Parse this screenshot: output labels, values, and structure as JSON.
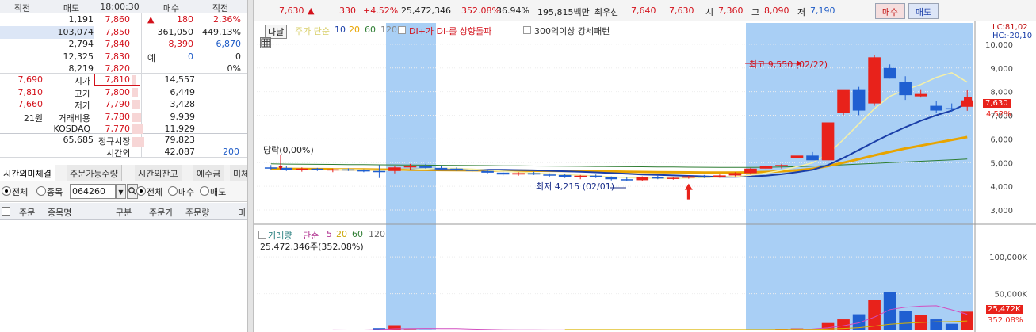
{
  "orderbook": {
    "headers": [
      "직전",
      "매도",
      "18:00:30",
      "매수",
      "직전"
    ],
    "ask_rows": [
      {
        "qty": "1,191",
        "price": "7,860",
        "bid": "180",
        "bidmark": "▲",
        "prev": "2.36%"
      },
      {
        "qty": "103,074",
        "price": "7,850",
        "bid": "361,050",
        "prev": "449.13%"
      },
      {
        "qty": "2,794",
        "price": "7,840",
        "bid": "8,390",
        "prev": "6,870"
      },
      {
        "qty": "12,325",
        "price": "7,830",
        "bidlabel": "예",
        "bid": "0",
        "prev": "0"
      },
      {
        "qty": "8,219",
        "price": "7,820",
        "prev": "0%"
      }
    ],
    "bid_rows": [
      {
        "left": "7,690",
        "label": "시가",
        "price": "7,810",
        "qty": "14,557"
      },
      {
        "left": "7,810",
        "label": "고가",
        "price": "7,800",
        "qty": "6,449"
      },
      {
        "left": "7,660",
        "label": "저가",
        "price": "7,790",
        "qty": "3,428"
      },
      {
        "left": "21원",
        "label": "거래비용",
        "price": "7,780",
        "qty": "9,939"
      },
      {
        "left": "",
        "label": "KOSDAQ",
        "price": "7,770",
        "qty": "11,929"
      }
    ],
    "summary": {
      "ask_total": "65,685",
      "session_label": "정규시장",
      "bid_total": "79,823",
      "after_label": "시간외",
      "after_qty": "42,087",
      "after_count": "200"
    }
  },
  "tabs": [
    "시간외미체결",
    "주문가능수량",
    "시간외잔고",
    "예수금",
    "미체"
  ],
  "filters": {
    "radio_all": "전체",
    "radio_stock": "종목",
    "code": "064260",
    "radio_all2": "전체",
    "radio_buy": "매수",
    "radio_sell": "매도"
  },
  "order_table": {
    "headers": [
      "주문",
      "종목명",
      "구분",
      "주문가",
      "주문량",
      "미"
    ]
  },
  "ticker": {
    "price": "7,630",
    "arrow": "▲",
    "change": "330",
    "change_pct": "+4.52%",
    "volume": "25,472,346",
    "vol_ratio": "352.08%",
    "turnover": "36.94%",
    "amount": "195,815백만",
    "best_ask_label": "최우선",
    "best_ask": "7,640",
    "best_bid": "7,630",
    "open_label": "시",
    "open": "7,360",
    "high_label": "고",
    "high": "8,090",
    "low_label": "저",
    "low": "7,190",
    "buy_button": "매수",
    "sell_button": "매도"
  },
  "price_legend": {
    "dropdown": "다날",
    "ma_label": "주가 단순",
    "ma_periods": [
      "5",
      "10",
      "20",
      "60",
      "120"
    ],
    "di_label": "DI+가 DI-를 상향돌파",
    "pattern_label": "300억이상 강세패턴"
  },
  "annotations": {
    "high_label": "최고 9,550 (02/22)",
    "low_label": "최저 4,215 (02/01)",
    "start_label": "당락(0,00%)",
    "lc": "LC:81,02",
    "hc": "HC:-20,10",
    "last_price": "7,630",
    "last_pct": "4.52%"
  },
  "volume_legend": {
    "label": "거래량",
    "ma_label": "단순",
    "ma_periods": [
      "5",
      "20",
      "60",
      "120"
    ],
    "value": "25,472,346주(352,08%)"
  },
  "volume_axis": {
    "last_value": "25,472K",
    "last_pct": "352.08%"
  },
  "colors": {
    "up": "#e8221b",
    "down": "#1f5fd1",
    "ma5": "#f5f0a8",
    "ma10": "#1a3ea8",
    "ma20": "#e8a400",
    "ma60": "#2e7d32",
    "highlight": "#a9cff5"
  },
  "chart_data": [
    {
      "type": "candlestick",
      "y_axis_ticks": [
        3000,
        4000,
        5000,
        6000,
        7000,
        8000,
        9000,
        10000
      ],
      "y_axis_labels": [
        "3,000",
        "4,000",
        "5,000",
        "6,000",
        "7,000",
        "8,000",
        "9,000",
        "10,000"
      ],
      "ylim": [
        2500,
        10900
      ],
      "candles": [
        [
          4800,
          4900,
          4700,
          4780
        ],
        [
          4780,
          4850,
          4650,
          4700
        ],
        [
          4700,
          4800,
          4620,
          4750
        ],
        [
          4750,
          4780,
          4650,
          4680
        ],
        [
          4680,
          4750,
          4600,
          4720
        ],
        [
          4720,
          4760,
          4650,
          4680
        ],
        [
          4680,
          4720,
          4600,
          4650
        ],
        [
          4650,
          4900,
          4350,
          4600
        ],
        [
          4650,
          4850,
          4550,
          4800
        ],
        [
          4800,
          4950,
          4700,
          4850
        ],
        [
          4850,
          4950,
          4750,
          4780
        ],
        [
          4780,
          4850,
          4700,
          4750
        ],
        [
          4750,
          4800,
          4650,
          4700
        ],
        [
          4700,
          4750,
          4600,
          4650
        ],
        [
          4650,
          4720,
          4550,
          4580
        ],
        [
          4580,
          4620,
          4450,
          4500
        ],
        [
          4500,
          4600,
          4450,
          4560
        ],
        [
          4560,
          4620,
          4480,
          4500
        ],
        [
          4500,
          4550,
          4400,
          4480
        ],
        [
          4480,
          4520,
          4350,
          4400
        ],
        [
          4400,
          4480,
          4300,
          4450
        ],
        [
          4450,
          4500,
          4350,
          4380
        ],
        [
          4380,
          4420,
          4250,
          4300
        ],
        [
          4300,
          4380,
          4215,
          4260
        ],
        [
          4260,
          4420,
          4220,
          4380
        ],
        [
          4380,
          4450,
          4300,
          4340
        ],
        [
          4340,
          4400,
          4280,
          4360
        ],
        [
          4360,
          4450,
          4320,
          4420
        ],
        [
          4420,
          4480,
          4350,
          4400
        ],
        [
          4400,
          4500,
          4360,
          4460
        ],
        [
          4460,
          4600,
          4420,
          4560
        ],
        [
          4560,
          4780,
          4500,
          4750
        ],
        [
          4750,
          4900,
          4700,
          4850
        ],
        [
          4850,
          4950,
          4750,
          4900
        ],
        [
          5200,
          5400,
          5100,
          5300
        ],
        [
          5300,
          5450,
          5200,
          5100
        ],
        [
          5100,
          6700,
          5050,
          6700
        ],
        [
          7100,
          7800,
          7000,
          8100
        ],
        [
          8100,
          8200,
          7000,
          7200
        ],
        [
          7500,
          9550,
          7400,
          9450
        ],
        [
          9000,
          9150,
          8550,
          8550
        ],
        [
          8400,
          8650,
          7650,
          7850
        ],
        [
          7800,
          8100,
          7750,
          7900
        ],
        [
          7400,
          7600,
          7100,
          7200
        ],
        [
          7300,
          7500,
          7150,
          7250
        ],
        [
          7360,
          8090,
          7190,
          7630
        ]
      ],
      "moving_averages": {
        "ma5": [
          null,
          null,
          null,
          null,
          4730,
          4720,
          4700,
          4690,
          4680,
          4700,
          4730,
          4760,
          4760,
          4730,
          4690,
          4640,
          4600,
          4560,
          4530,
          4500,
          4470,
          4440,
          4400,
          4370,
          4350,
          4340,
          4340,
          4350,
          4370,
          4390,
          4420,
          4470,
          4560,
          4680,
          4830,
          4990,
          5360,
          5980,
          6640,
          7280,
          7800,
          8080,
          8300,
          8600,
          8800,
          8400
        ],
        "ma10": [
          null,
          null,
          null,
          null,
          null,
          null,
          null,
          null,
          null,
          4710,
          4710,
          4700,
          4700,
          4700,
          4700,
          4700,
          4690,
          4680,
          4660,
          4640,
          4620,
          4590,
          4560,
          4530,
          4500,
          4480,
          4460,
          4440,
          4420,
          4400,
          4400,
          4420,
          4450,
          4510,
          4600,
          4700,
          4900,
          5200,
          5540,
          5880,
          6200,
          6500,
          6770,
          7000,
          7200,
          7500
        ],
        "ma20": [
          4750,
          4740,
          4735,
          4730,
          4725,
          4720,
          4715,
          4710,
          4705,
          4700,
          4695,
          4690,
          4685,
          4680,
          4675,
          4670,
          4665,
          4660,
          4655,
          4650,
          4645,
          4640,
          4630,
          4620,
          4610,
          4600,
          4595,
          4590,
          4585,
          4580,
          4580,
          4590,
          4610,
          4640,
          4680,
          4740,
          4860,
          5000,
          5150,
          5310,
          5460,
          5600,
          5720,
          5840,
          5960,
          6080
        ],
        "ma60": [
          4950,
          4940,
          4935,
          4930,
          4925,
          4920,
          4915,
          4910,
          4905,
          4900,
          4895,
          4890,
          4885,
          4880,
          4875,
          4870,
          4865,
          4860,
          4855,
          4850,
          4845,
          4840,
          4835,
          4830,
          4825,
          4820,
          4815,
          4810,
          4805,
          4800,
          4800,
          4800,
          4805,
          4815,
          4830,
          4850,
          4880,
          4910,
          4940,
          4970,
          5000,
          5030,
          5060,
          5090,
          5120,
          5150
        ]
      }
    },
    {
      "type": "bar",
      "y_axis_ticks": [
        50000,
        100000
      ],
      "y_axis_labels": [
        "50,000K",
        "100,000K"
      ],
      "ylim": [
        0,
        140000
      ],
      "volumes": [
        700,
        600,
        600,
        550,
        600,
        550,
        500,
        3000,
        7000,
        1500,
        1200,
        1000,
        900,
        800,
        700,
        600,
        500,
        500,
        600,
        500,
        500,
        700,
        600,
        600,
        900,
        700,
        500,
        600,
        500,
        600,
        700,
        800,
        1200,
        2000,
        2500,
        1500,
        10000,
        15000,
        22000,
        42000,
        52000,
        26000,
        21000,
        15000,
        9000,
        25472
      ],
      "vol_ma5": [
        null,
        null,
        null,
        null,
        600,
        580,
        560,
        1040,
        2200,
        2500,
        2600,
        2500,
        2400,
        1700,
        1300,
        1000,
        900,
        900,
        700,
        600,
        560,
        560,
        580,
        600,
        660,
        700,
        700,
        660,
        660,
        600,
        620,
        640,
        720,
        1060,
        1440,
        1700,
        3440,
        6300,
        10200,
        18100,
        28200,
        31400,
        33000,
        33500,
        28000,
        22000
      ],
      "vol_ma20": [
        null,
        null,
        null,
        null,
        null,
        null,
        null,
        null,
        null,
        null,
        null,
        null,
        null,
        null,
        null,
        null,
        null,
        null,
        null,
        1200,
        1200,
        1210,
        1200,
        1180,
        1200,
        1190,
        1180,
        1190,
        1180,
        1180,
        1190,
        1200,
        1210,
        1300,
        1380,
        1420,
        1880,
        2600,
        3700,
        5800,
        8400,
        9700,
        10800,
        11500,
        12000,
        12800
      ]
    }
  ]
}
